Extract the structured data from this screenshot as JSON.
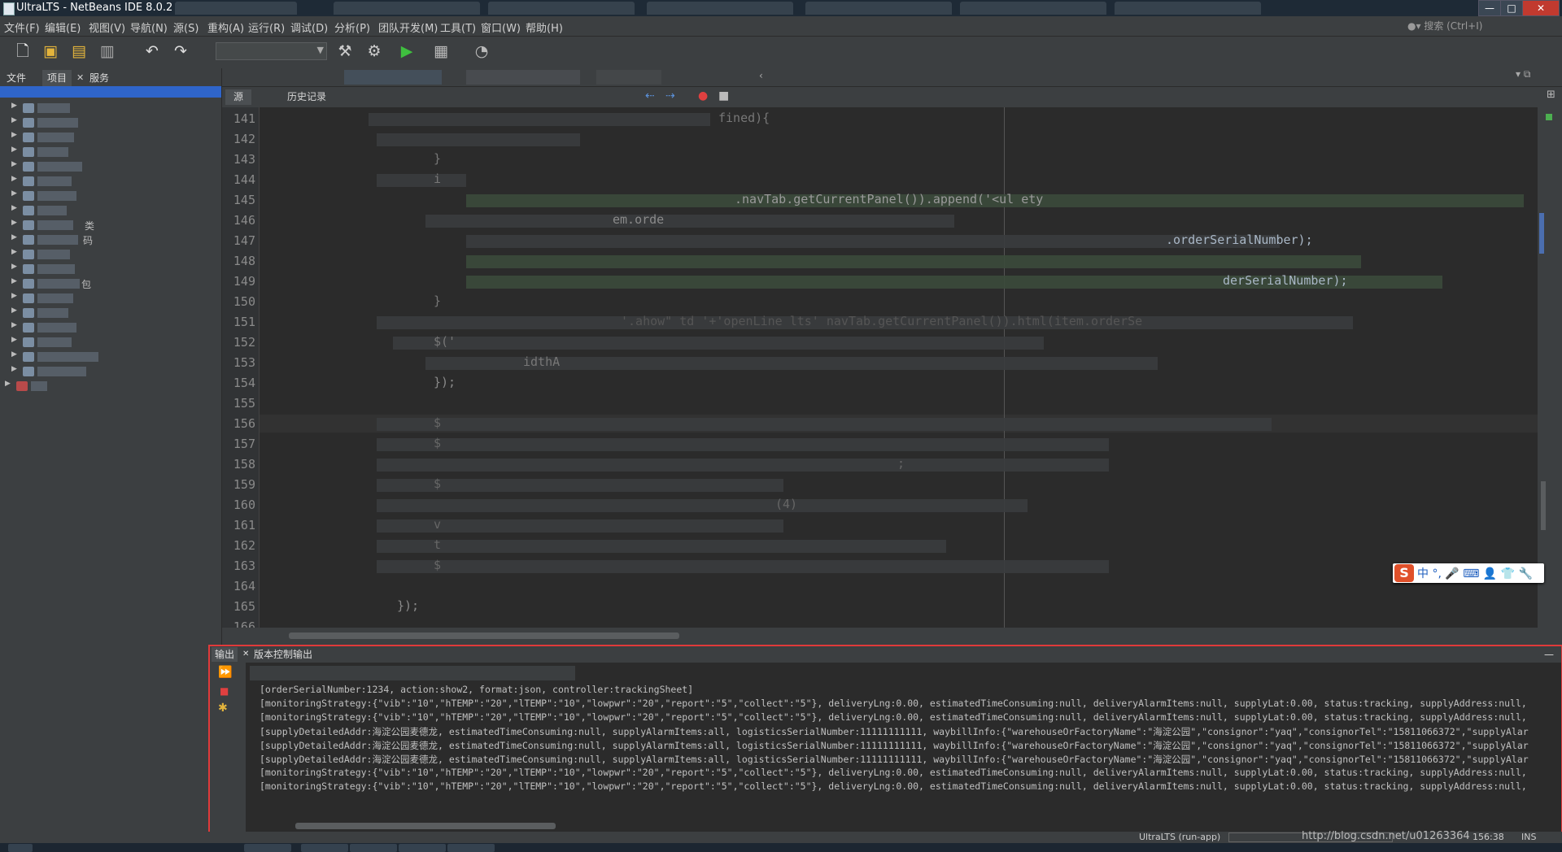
{
  "window": {
    "title": "UltraLTS - NetBeans IDE 8.0.2",
    "buttons": {
      "minimize": "—",
      "maximize": "□",
      "close": "✕"
    }
  },
  "menubar": {
    "items": [
      "文件(F)",
      "编辑(E)",
      "视图(V)",
      "导航(N)",
      "源(S)",
      "重构(A)",
      "运行(R)",
      "调试(D)",
      "分析(P)",
      "团队开发(M)",
      "工具(T)",
      "窗口(W)",
      "帮助(H)"
    ],
    "search_placeholder": "搜索 (Ctrl+I)"
  },
  "toolbar": {
    "icons": [
      "new-file",
      "new-project",
      "open-project",
      "close-project",
      "undo",
      "redo",
      "build",
      "clean-build",
      "run",
      "debug",
      "profile"
    ]
  },
  "left_panel": {
    "tabs": [
      "文件",
      "项目",
      "服务"
    ],
    "visible_fragments": [
      "类",
      "码",
      "包"
    ]
  },
  "editor": {
    "subtabs": [
      "源",
      "历史记录"
    ],
    "line_numbers": [
      "141",
      "142",
      "143",
      "144",
      "145",
      "146",
      "147",
      "148",
      "149",
      "150",
      "151",
      "152",
      "153",
      "154",
      "155",
      "156",
      "157",
      "158",
      "159",
      "160",
      "161",
      "162",
      "163",
      "164",
      "165",
      "166"
    ],
    "visible_code": {
      "141": "fined){",
      "143": "}",
      "144": "i",
      "145": ".navTab.getCurrentPanel()).append('<ul ety",
      "146": "em.orde",
      "147": ".orderSerialNumber);",
      "149": "derSerialNumber);",
      "150": "}",
      "151": "'.ahow\" td '+'openLine lts' navTab.getCurrentPanel()).html(item.orderSe",
      "152": "$('",
      "153": "idthA",
      "154": "});",
      "156": "$",
      "157": "$",
      "158": ";",
      "159": "$",
      "160": "(4)",
      "161": "v",
      "162": "t",
      "163": "$",
      "165": "});"
    }
  },
  "ime": {
    "logo": "S",
    "label": "中 °, 🎤 ⌨ 👤 👕 🔧"
  },
  "output": {
    "tabs": [
      "输出",
      "版本控制输出"
    ],
    "lines": [
      "[orderSerialNumber:1234, action:show2, format:json, controller:trackingSheet]",
      "[monitoringStrategy:{\"vib\":\"10\",\"hTEMP\":\"20\",\"lTEMP\":\"10\",\"lowpwr\":\"20\",\"report\":\"5\",\"collect\":\"5\"}, deliveryLng:0.00, estimatedTimeConsuming:null, deliveryAlarmItems:null, supplyLat:0.00, status:tracking, supplyAddress:null,",
      "[monitoringStrategy:{\"vib\":\"10\",\"hTEMP\":\"20\",\"lTEMP\":\"10\",\"lowpwr\":\"20\",\"report\":\"5\",\"collect\":\"5\"}, deliveryLng:0.00, estimatedTimeConsuming:null, deliveryAlarmItems:null, supplyLat:0.00, status:tracking, supplyAddress:null,",
      "[supplyDetailedAddr:海淀公园麦德龙, estimatedTimeConsuming:null, supplyAlarmItems:all, logisticsSerialNumber:11111111111, waybillInfo:{\"warehouseOrFactoryName\":\"海淀公园\",\"consignor\":\"yaq\",\"consignorTel\":\"15811066372\",\"supplyAlar",
      "[supplyDetailedAddr:海淀公园麦德龙, estimatedTimeConsuming:null, supplyAlarmItems:all, logisticsSerialNumber:11111111111, waybillInfo:{\"warehouseOrFactoryName\":\"海淀公园\",\"consignor\":\"yaq\",\"consignorTel\":\"15811066372\",\"supplyAlar",
      "[supplyDetailedAddr:海淀公园麦德龙, estimatedTimeConsuming:null, supplyAlarmItems:all, logisticsSerialNumber:11111111111, waybillInfo:{\"warehouseOrFactoryName\":\"海淀公园\",\"consignor\":\"yaq\",\"consignorTel\":\"15811066372\",\"supplyAlar",
      "[monitoringStrategy:{\"vib\":\"10\",\"hTEMP\":\"20\",\"lTEMP\":\"10\",\"lowpwr\":\"20\",\"report\":\"5\",\"collect\":\"5\"}, deliveryLng:0.00, estimatedTimeConsuming:null, deliveryAlarmItems:null, supplyLat:0.00, status:tracking, supplyAddress:null,",
      "[monitoringStrategy:{\"vib\":\"10\",\"hTEMP\":\"20\",\"lTEMP\":\"10\",\"lowpwr\":\"20\",\"report\":\"5\",\"collect\":\"5\"}, deliveryLng:0.00, estimatedTimeConsuming:null, deliveryAlarmItems:null, supplyLat:0.00, status:tracking, supplyAddress:null,"
    ]
  },
  "statusbar": {
    "run_label": "UltraLTS (run-app)",
    "watermark": "http://blog.csdn.net/u01263364",
    "position": "156:38",
    "mode": "INS"
  },
  "colors": {
    "highlight_border": "#e03a3a",
    "editor_bg": "#2b2b2b",
    "ide_bg": "#3c3f41"
  }
}
